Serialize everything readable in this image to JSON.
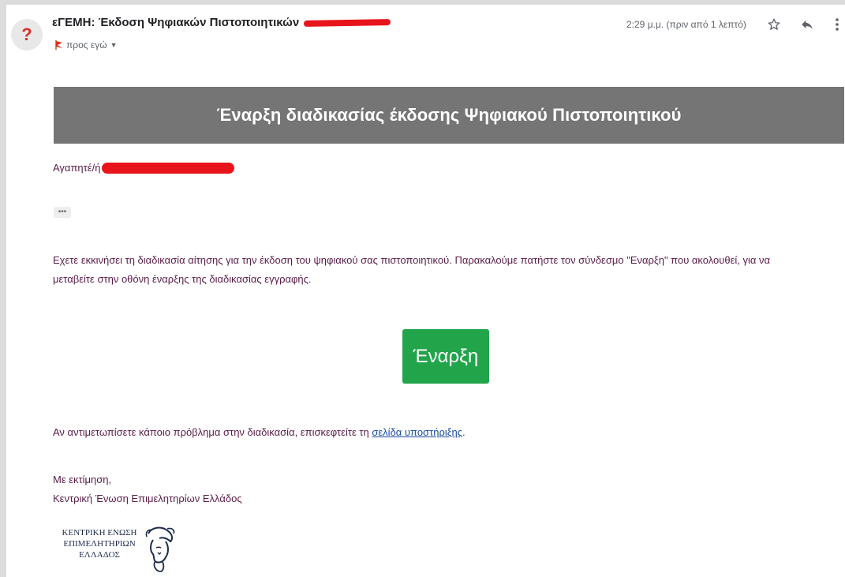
{
  "email": {
    "sender_avatar_glyph": "?",
    "subject": "εΓΕΜΗ: Έκδοση Ψηφιακών Πιστοποιητικών",
    "to_label": "προς εγώ",
    "time": "2:29 μ.μ. (πριν από 1 λεπτό)",
    "icons": {
      "star": "star-icon",
      "reply": "reply-icon",
      "more": "more-vert-icon",
      "flag": "important-flag-icon"
    }
  },
  "content": {
    "banner_title": "Έναρξη διαδικασίας έκδοσης Ψηφιακού Πιστοποιητικού",
    "greeting": "Αγαπητέ/ή",
    "ellipsis": "•••",
    "body": "Εχετε εκκινήσει τη διαδικασία αίτησης για την έκδοση του ψηφιακού σας πιστοποιητικού. Παρακαλούμε πατήστε τον σύνδεσμο \"Εναρξη\" που ακολουθεί, για να μεταβείτε στην οθόνη έναρξης της διαδικασίας εγγραφής.",
    "start_button": "Έναρξη",
    "help_prefix": "Αν αντιμετωπίσετε κάποιο πρόβλημα στην διαδικασία, επισκεφτείτε τη ",
    "help_link": "σελίδα υποστήριξης",
    "help_suffix": ".",
    "signoff_line1": "Με εκτίμηση,",
    "signoff_line2": "Κεντρική Ένωση Επιμελητηρίων Ελλάδος"
  },
  "logo": {
    "line1": "ΚΕΝΤΡΙΚΗ ΕΝΩΣΗ",
    "line2": "ΕΠΙΜΕΛΗΤΗΡΙΩΝ",
    "line3": "ΕΛΛΑΔΟΣ"
  },
  "colors": {
    "banner_bg": "#757575",
    "button_bg": "#22a44b",
    "body_text": "#5a1c48",
    "link": "#1a4ba0",
    "redaction": "#e8141c"
  }
}
